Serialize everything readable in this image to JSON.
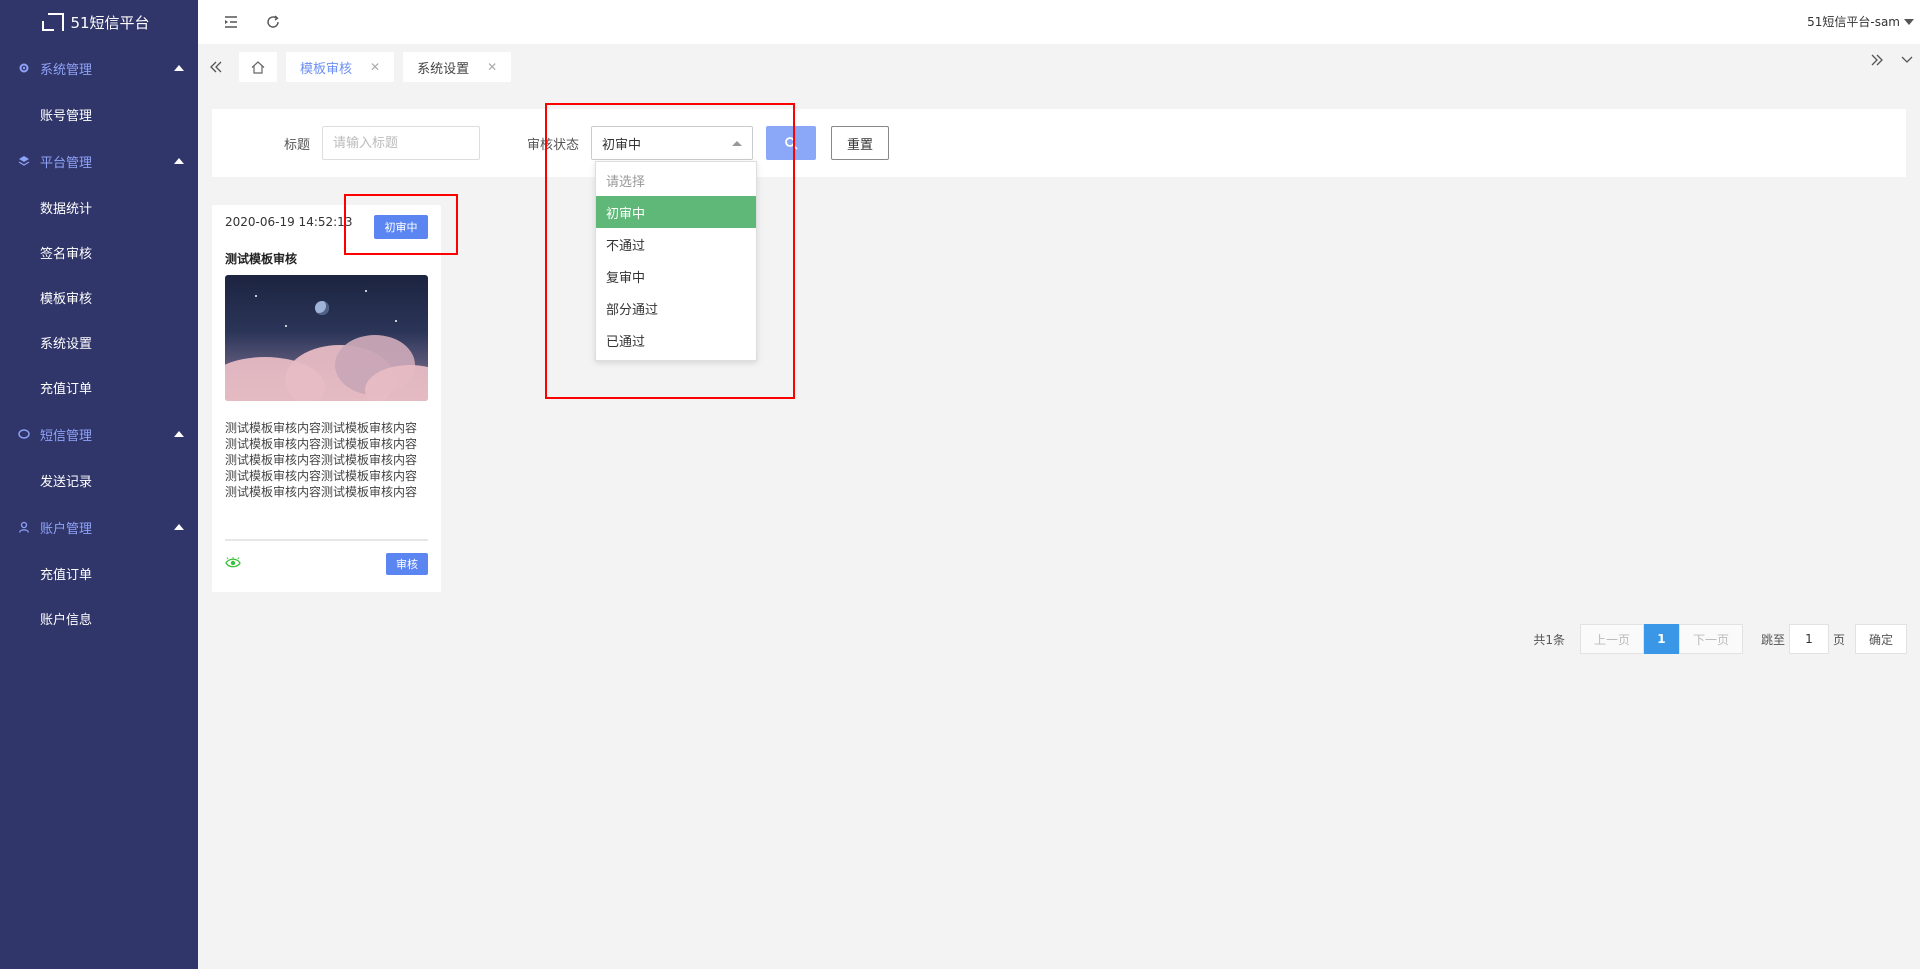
{
  "app": {
    "logo_text": "51短信平台"
  },
  "sidebar": {
    "groups": [
      {
        "label": "系统管理",
        "items": [
          "账号管理"
        ]
      },
      {
        "label": "平台管理",
        "items": [
          "数据统计",
          "签名审核",
          "模板审核",
          "系统设置",
          "充值订单"
        ]
      },
      {
        "label": "短信管理",
        "items": [
          "发送记录"
        ]
      },
      {
        "label": "账户管理",
        "items": [
          "充值订单",
          "账户信息"
        ]
      }
    ]
  },
  "topbar": {
    "user": "51短信平台-sam"
  },
  "tabs": [
    {
      "label": "模板审核",
      "active": true
    },
    {
      "label": "系统设置",
      "active": false
    }
  ],
  "filter": {
    "title_label": "标题",
    "title_placeholder": "请输入标题",
    "status_label": "审核状态",
    "status_value": "初审中",
    "reset_label": "重置"
  },
  "dropdown": {
    "options": [
      "请选择",
      "初审中",
      "不通过",
      "复审中",
      "部分通过",
      "已通过"
    ],
    "selected": "初审中"
  },
  "card": {
    "date": "2020-06-19 14:52:13",
    "badge": "初审中",
    "title": "测试模板审核",
    "content": "测试模板审核内容测试模板审核内容\n测试模板审核内容测试模板审核内容\n测试模板审核内容测试模板审核内容\n测试模板审核内容测试模板审核内容\n测试模板审核内容测试模板审核内容",
    "review_label": "审核"
  },
  "pagination": {
    "total": "共1条",
    "prev": "上一页",
    "current": "1",
    "next": "下一页",
    "goto_label": "跳至",
    "goto_value": "1",
    "page_unit": "页",
    "confirm": "确定"
  },
  "colors": {
    "sidebar_bg": "#30356a",
    "accent": "#5b86f2",
    "selected_option": "#5fb878",
    "annotation": "#ff0000"
  }
}
